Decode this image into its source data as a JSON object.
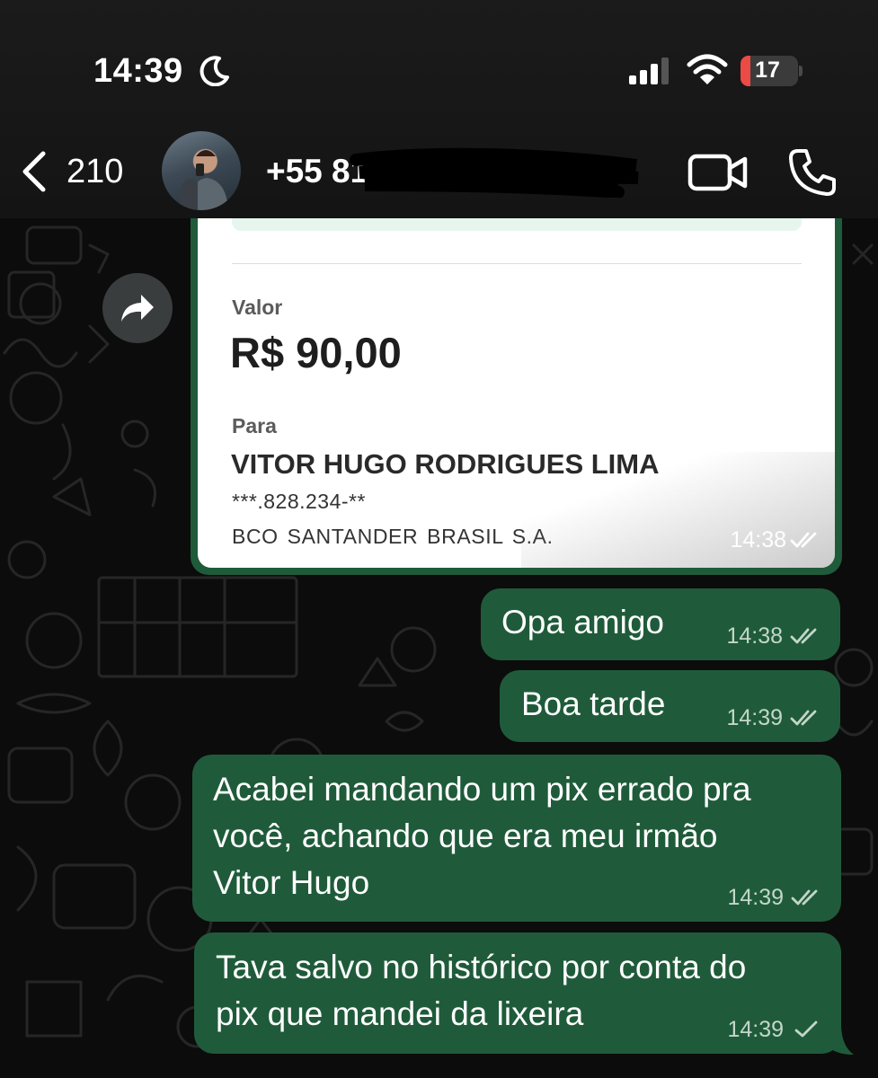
{
  "status_bar": {
    "time": "14:39",
    "battery_level": "17",
    "battery_fraction": 0.17
  },
  "header": {
    "back_count": "210",
    "contact_name": "+55 81",
    "icons": [
      "chevron-left-icon",
      "avatar",
      "video-call-icon",
      "phone-call-icon"
    ]
  },
  "receipt": {
    "valor_label": "Valor",
    "valor_amount": "R$ 90,00",
    "para_label": "Para",
    "recipient_name": "VITOR HUGO RODRIGUES LIMA",
    "recipient_doc": "***.828.234-**",
    "recipient_bank": "BCO SANTANDER  BRASIL  S.A.",
    "time": "14:38",
    "status": "read"
  },
  "messages": [
    {
      "text": "Opa amigo",
      "time": "14:38",
      "status": "read"
    },
    {
      "text": "Boa tarde",
      "time": "14:39",
      "status": "read"
    },
    {
      "text": "Acabei mandando um pix errado pra\nvocê, achando que era meu irmão\nVitor Hugo",
      "time": "14:39",
      "status": "read"
    },
    {
      "text": "Tava salvo no histórico por conta do\npix que mandei da lixeira",
      "time": "14:39",
      "status": "sent"
    }
  ],
  "colors": {
    "outgoing_bubble": "#1f5b3a",
    "header_bg": "#171717",
    "wallpaper": "#0c0c0c",
    "battery_low": "#eb4a45"
  }
}
